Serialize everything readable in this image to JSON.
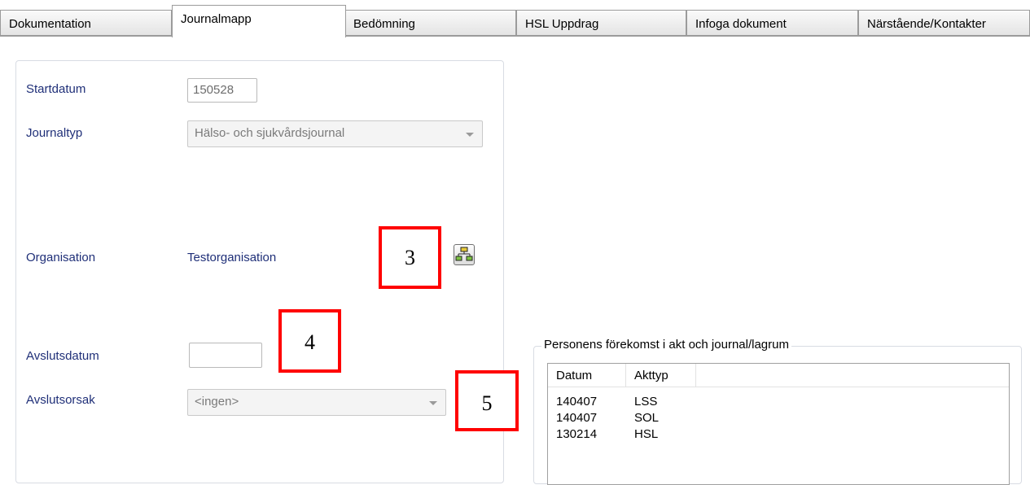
{
  "tabs": [
    {
      "label": "Dokumentation",
      "active": false
    },
    {
      "label": "Journalmapp",
      "active": true
    },
    {
      "label": "Bedömning",
      "active": false
    },
    {
      "label": "HSL Uppdrag",
      "active": false
    },
    {
      "label": "Infoga dokument",
      "active": false
    },
    {
      "label": "Närstående/Kontakter",
      "active": false
    }
  ],
  "form": {
    "startdatum_label": "Startdatum",
    "startdatum_value": "150528",
    "journaltyp_label": "Journaltyp",
    "journaltyp_value": "Hälso- och sjukvårdsjournal",
    "organisation_label": "Organisation",
    "organisation_value": "Testorganisation",
    "organisation_button_icon": "org-tree-icon",
    "avslutsdatum_label": "Avslutsdatum",
    "avslutsdatum_value": "",
    "avslutsorsak_label": "Avslutsorsak",
    "avslutsorsak_value": "<ingen>"
  },
  "annotations": [
    "3",
    "4",
    "5"
  ],
  "occurrence": {
    "title": "Personens förekomst i akt och journal/lagrum",
    "columns": [
      "Datum",
      "Akttyp"
    ],
    "rows": [
      {
        "datum": "140407",
        "akttyp": "LSS"
      },
      {
        "datum": "140407",
        "akttyp": "SOL"
      },
      {
        "datum": "130214",
        "akttyp": "HSL"
      }
    ]
  },
  "colors": {
    "label_text": "#1f2f78",
    "annotation_border": "#ff0000",
    "tab_border": "#9b9b9b"
  }
}
